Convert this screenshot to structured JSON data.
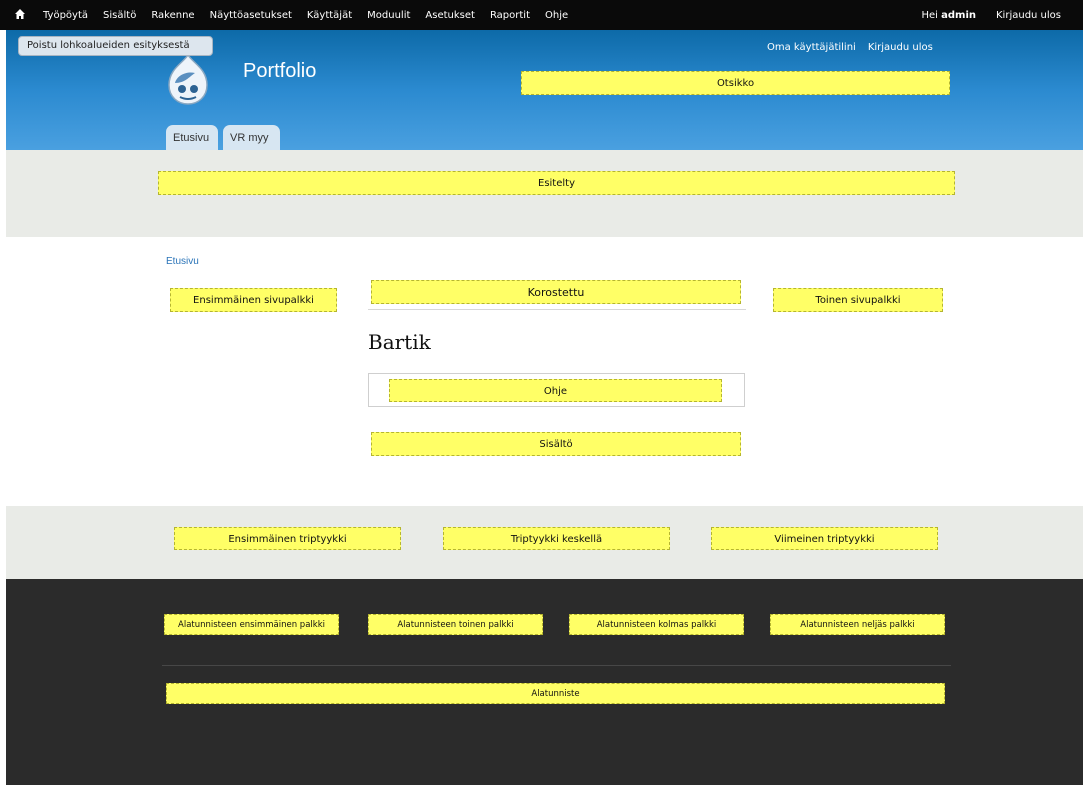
{
  "toolbar": {
    "home_icon": "home-icon",
    "menu": [
      "Työpöytä",
      "Sisältö",
      "Rakenne",
      "Näyttöasetukset",
      "Käyttäjät",
      "Moduulit",
      "Asetukset",
      "Raportit",
      "Ohje"
    ],
    "greeting_prefix": "Hei",
    "username": "admin",
    "logout": "Kirjaudu ulos"
  },
  "exit_demo": "Poistu lohkoalueiden esityksestä",
  "header": {
    "logo_icon": "drupal-logo-icon",
    "site_name": "Portfolio",
    "secondary_menu": [
      "Oma käyttäjätilini",
      "Kirjaudu ulos"
    ],
    "tabs": [
      "Etusivu",
      "VR myy"
    ]
  },
  "regions": {
    "header": "Otsikko",
    "featured": "Esitelty",
    "sidebar_first": "Ensimmäinen sivupalkki",
    "highlighted": "Korostettu",
    "sidebar_second": "Toinen sivupalkki",
    "help": "Ohje",
    "content": "Sisältö",
    "triptych_first": "Ensimmäinen triptyykki",
    "triptych_middle": "Triptyykki keskellä",
    "triptych_last": "Viimeinen triptyykki",
    "footer_firstcolumn": "Alatunnisteen ensimmäinen palkki",
    "footer_secondcolumn": "Alatunnisteen toinen palkki",
    "footer_thirdcolumn": "Alatunnisteen kolmas palkki",
    "footer_fourthcolumn": "Alatunnisteen neljäs palkki",
    "footer": "Alatunniste"
  },
  "breadcrumb": "Etusivu",
  "page_title": "Bartik",
  "colors": {
    "toolbar": "#0a0a0a",
    "header_top": "#0d6aa8",
    "header_bottom": "#4aa0e0",
    "region_fill": "#ffff66",
    "band_light": "#e9ebe7",
    "footer_dark": "#2b2b2b",
    "link": "#2a74b8"
  }
}
